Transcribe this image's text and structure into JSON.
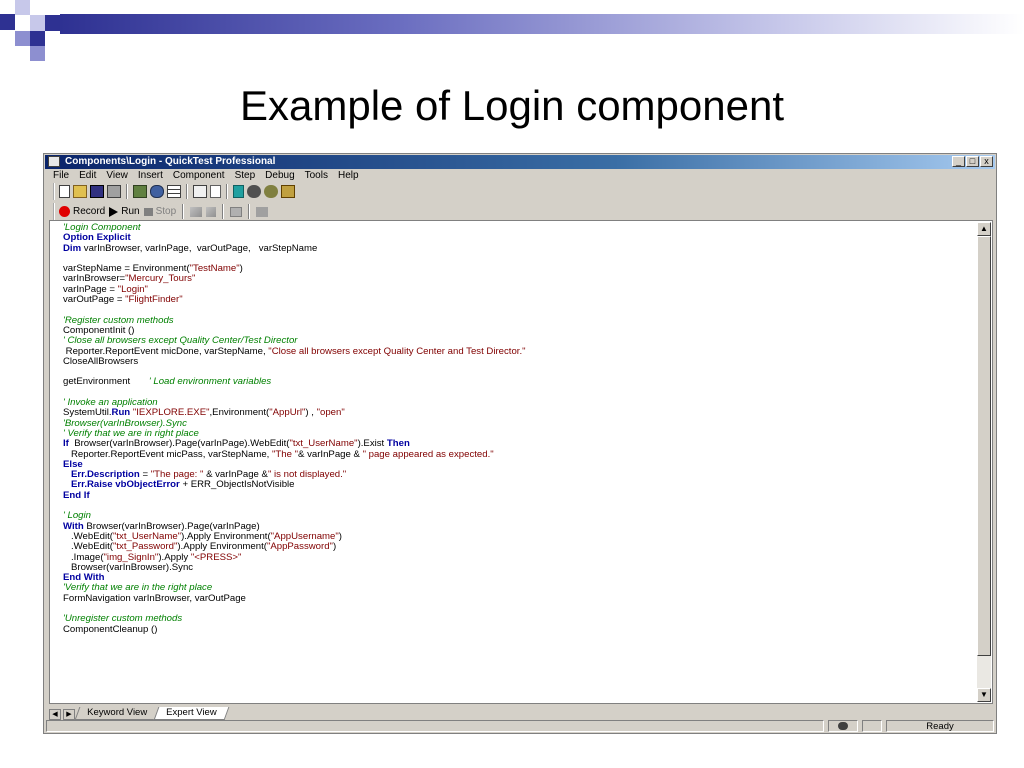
{
  "slide": {
    "title": "Example of Login component"
  },
  "window": {
    "title": "Components\\Login - QuickTest Professional",
    "caption_buttons": [
      "_",
      "□",
      "x"
    ]
  },
  "menu": [
    "File",
    "Edit",
    "View",
    "Insert",
    "Component",
    "Step",
    "Debug",
    "Tools",
    "Help"
  ],
  "toolbar": {
    "icons": [
      "new-icon",
      "open-icon",
      "save-icon",
      "print-icon",
      "object-repository-icon",
      "object-spy-icon",
      "data-table-icon",
      "step-generator-icon",
      "checkpoint-icon",
      "test-settings-icon",
      "options-icon",
      "results-icon",
      "spy-icon"
    ],
    "record_label": "Record",
    "run_label": "Run",
    "stop_label": "Stop"
  },
  "code": [
    [
      {
        "t": "'Login Component",
        "c": "cmt"
      }
    ],
    [
      {
        "t": "Option Explicit",
        "c": "kw"
      }
    ],
    [
      {
        "t": "Dim",
        "c": "kw"
      },
      {
        "t": " varInBrowser, varInPage,  varOutPage,   varStepName"
      }
    ],
    [],
    [
      {
        "t": "varStepName = Environment("
      },
      {
        "t": "\"TestName\"",
        "c": "str"
      },
      {
        "t": ")"
      }
    ],
    [
      {
        "t": "varInBrowser="
      },
      {
        "t": "\"Mercury_Tours\"",
        "c": "str"
      }
    ],
    [
      {
        "t": "varInPage = "
      },
      {
        "t": "\"Login\"",
        "c": "str"
      }
    ],
    [
      {
        "t": "varOutPage = "
      },
      {
        "t": "\"FlightFinder\"",
        "c": "str"
      }
    ],
    [],
    [
      {
        "t": "'Register custom methods",
        "c": "cmt"
      }
    ],
    [
      {
        "t": "ComponentInit ()"
      }
    ],
    [
      {
        "t": "' Close all browsers except Quality Center/Test Director",
        "c": "cmt"
      }
    ],
    [
      {
        "t": " Reporter.ReportEvent micDone, varStepName, "
      },
      {
        "t": "\"Close all browsers except Quality Center and Test Director.\"",
        "c": "str"
      }
    ],
    [
      {
        "t": "CloseAllBrowsers"
      }
    ],
    [],
    [
      {
        "t": "getEnvironment       "
      },
      {
        "t": "' Load environment variables",
        "c": "cmt"
      }
    ],
    [],
    [
      {
        "t": "' Invoke an application",
        "c": "cmt"
      }
    ],
    [
      {
        "t": "SystemUtil."
      },
      {
        "t": "Run",
        "c": "kw"
      },
      {
        "t": " "
      },
      {
        "t": "\"IEXPLORE.EXE\"",
        "c": "str"
      },
      {
        "t": ",Environment("
      },
      {
        "t": "\"AppUrl\"",
        "c": "str"
      },
      {
        "t": ") , "
      },
      {
        "t": "\"open\"",
        "c": "str"
      }
    ],
    [
      {
        "t": "'Browser(varInBrowser).Sync",
        "c": "cmt"
      }
    ],
    [
      {
        "t": "' Verify that we are in right place",
        "c": "cmt"
      }
    ],
    [
      {
        "t": "If",
        "c": "kw"
      },
      {
        "t": "  Browser(varInBrowser).Page(varInPage).WebEdit("
      },
      {
        "t": "\"txt_UserName\"",
        "c": "str"
      },
      {
        "t": ").Exist "
      },
      {
        "t": "Then",
        "c": "kw"
      }
    ],
    [
      {
        "t": "   Reporter.ReportEvent micPass, varStepName, "
      },
      {
        "t": "\"The \"",
        "c": "str"
      },
      {
        "t": "& varInPage & "
      },
      {
        "t": "\" page appeared as expected.\"",
        "c": "str"
      }
    ],
    [
      {
        "t": "Else",
        "c": "kw"
      }
    ],
    [
      {
        "t": "   "
      },
      {
        "t": "Err.Description",
        "c": "kw"
      },
      {
        "t": " = "
      },
      {
        "t": "\"The page: \"",
        "c": "str"
      },
      {
        "t": " & varInPage &"
      },
      {
        "t": "\" is not displayed.\"",
        "c": "str"
      }
    ],
    [
      {
        "t": "   "
      },
      {
        "t": "Err.Raise vbObjectError",
        "c": "kw"
      },
      {
        "t": " + ERR_ObjectIsNotVisible"
      }
    ],
    [
      {
        "t": "End If",
        "c": "kw"
      }
    ],
    [],
    [
      {
        "t": "' Login",
        "c": "cmt"
      }
    ],
    [
      {
        "t": "With",
        "c": "kw"
      },
      {
        "t": " Browser(varInBrowser).Page(varInPage)"
      }
    ],
    [
      {
        "t": "   .WebEdit("
      },
      {
        "t": "\"txt_UserName\"",
        "c": "str"
      },
      {
        "t": ").Apply Environment("
      },
      {
        "t": "\"AppUsername\"",
        "c": "str"
      },
      {
        "t": ")"
      }
    ],
    [
      {
        "t": "   .WebEdit("
      },
      {
        "t": "\"txt_Password\"",
        "c": "str"
      },
      {
        "t": ").Apply Environment("
      },
      {
        "t": "\"AppPassword\"",
        "c": "str"
      },
      {
        "t": ")"
      }
    ],
    [
      {
        "t": "   .Image("
      },
      {
        "t": "\"img_SignIn\"",
        "c": "str"
      },
      {
        "t": ").Apply "
      },
      {
        "t": "\"<PRESS>\"",
        "c": "str"
      }
    ],
    [
      {
        "t": "   Browser(varInBrowser).Sync"
      }
    ],
    [
      {
        "t": "End With",
        "c": "kw"
      }
    ],
    [
      {
        "t": "'Verify that we are in the right place",
        "c": "cmt"
      }
    ],
    [
      {
        "t": "FormNavigation varInBrowser, varOutPage"
      }
    ],
    [],
    [
      {
        "t": "'Unregister custom methods",
        "c": "cmt"
      }
    ],
    [
      {
        "t": "ComponentCleanup ()"
      }
    ]
  ],
  "tabs": [
    {
      "label": "Keyword View",
      "active": false
    },
    {
      "label": "Expert View",
      "active": true
    }
  ],
  "status": {
    "text": "Ready"
  },
  "colors": {
    "comment": "#008000",
    "string": "#800000",
    "keyword": "#0000a0",
    "titlebar": "#0a246a",
    "slide_accent": "#2e3192"
  }
}
